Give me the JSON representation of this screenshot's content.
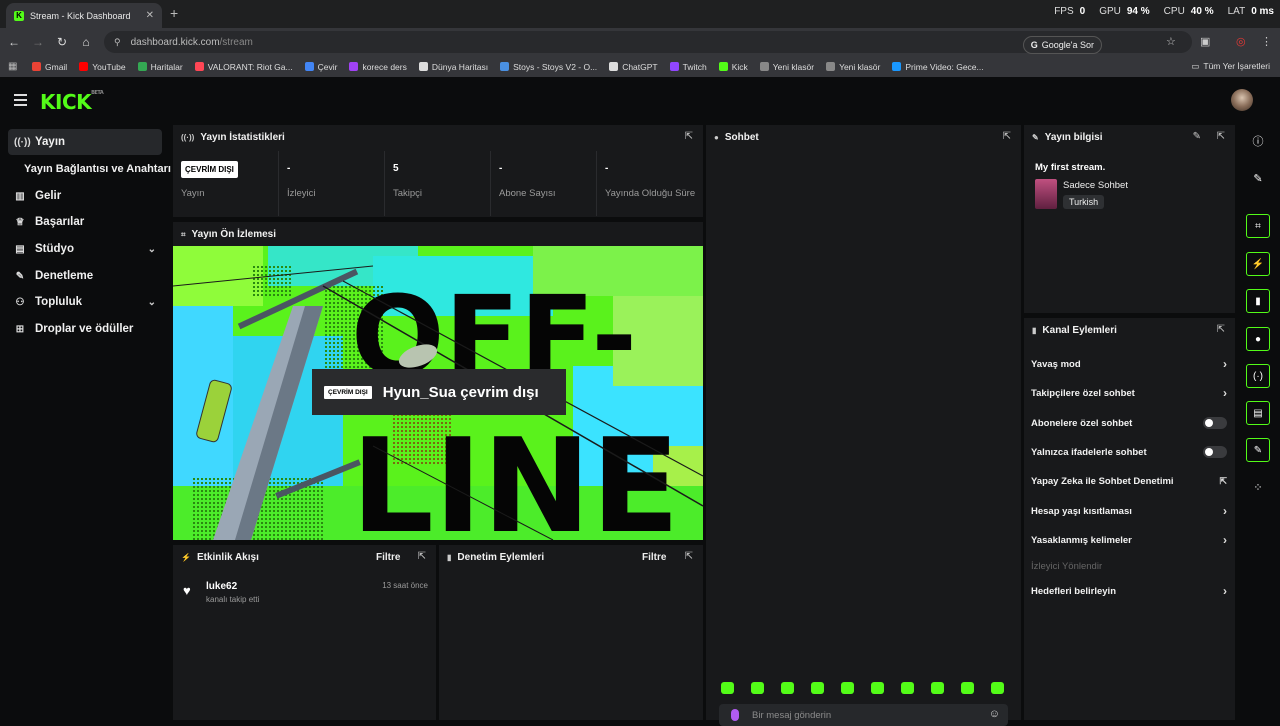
{
  "browser": {
    "tab_title": "Stream - Kick Dashboard",
    "new_tab": "+",
    "close_tab": "✕",
    "perf": [
      {
        "label": "FPS",
        "value": "0"
      },
      {
        "label": "GPU",
        "value": "94 %"
      },
      {
        "label": "CPU",
        "value": "40 %"
      },
      {
        "label": "LAT",
        "value": "0 ms"
      }
    ],
    "url_host": "dashboard.kick.com",
    "url_path": "/stream",
    "google_button": "Google'a Sor",
    "bookmarks": [
      {
        "label": "Gmail",
        "color": "#ea4335"
      },
      {
        "label": "YouTube",
        "color": "#ff0000"
      },
      {
        "label": "Haritalar",
        "color": "#34a853"
      },
      {
        "label": "VALORANT: Riot Ga...",
        "color": "#ff4655"
      },
      {
        "label": "Çevir",
        "color": "#4285f4"
      },
      {
        "label": "korece ders",
        "color": "#a142f4"
      },
      {
        "label": "Dünya Haritası",
        "color": "#dddddd"
      },
      {
        "label": "Stoys - Stoys V2 - O...",
        "color": "#4a90e2"
      },
      {
        "label": "ChatGPT",
        "color": "#dddddd"
      },
      {
        "label": "Twitch",
        "color": "#9146ff"
      },
      {
        "label": "Kick",
        "color": "#53fc18"
      },
      {
        "label": "Yeni klasör",
        "color": "#888888"
      },
      {
        "label": "Yeni klasör",
        "color": "#888888"
      },
      {
        "label": "Prime Video: Gece...",
        "color": "#1a98ff"
      }
    ],
    "all_bookmarks": "Tüm Yer İşaretleri"
  },
  "app": {
    "logo": "KICK",
    "logo_beta": "BETA",
    "accent": "#53fc18"
  },
  "sidebar": {
    "items": [
      {
        "label": "Yayın",
        "icon": "broadcast-icon"
      },
      {
        "label": "Yayın Bağlantısı ve Anahtarı",
        "icon": ""
      },
      {
        "label": "Gelir",
        "icon": "chart-icon"
      },
      {
        "label": "Başarılar",
        "icon": "trophy-icon"
      },
      {
        "label": "Stüdyo",
        "icon": "studio-icon"
      },
      {
        "label": "Denetleme",
        "icon": "wrench-icon"
      },
      {
        "label": "Topluluk",
        "icon": "people-icon"
      },
      {
        "label": "Droplar ve ödüller",
        "icon": "gift-icon"
      }
    ]
  },
  "stats": {
    "title": "Yayın İstatistikleri",
    "offline_badge": "ÇEVRİM DIŞI",
    "items": [
      {
        "value": "",
        "label": "Yayın"
      },
      {
        "value": "-",
        "label": "İzleyici"
      },
      {
        "value": "5",
        "label": "Takipçi"
      },
      {
        "value": "-",
        "label": "Abone Sayısı"
      },
      {
        "value": "-",
        "label": "Yayında Olduğu Süre"
      }
    ]
  },
  "preview": {
    "title": "Yayın Ön İzlemesi",
    "off_text": "OFF-",
    "line_text": "LINE",
    "badge": "ÇEVRİM DIŞI",
    "status": "Hyun_Sua çevrim dışı"
  },
  "activity": {
    "title": "Etkinlik Akışı",
    "filter": "Filtre",
    "items": [
      {
        "user": "luke62",
        "action": "kanalı takip etti",
        "time": "13 saat önce"
      }
    ]
  },
  "moderation": {
    "title": "Denetim Eylemleri",
    "filter": "Filtre"
  },
  "chat": {
    "title": "Sohbet",
    "placeholder": "Bir mesaj gönderin"
  },
  "stream_info": {
    "title": "Yayın bilgisi",
    "stream_title": "My first stream.",
    "category": "Sadece Sohbet",
    "language": "Turkish"
  },
  "channel_actions": {
    "title": "Kanal Eylemleri",
    "rows": [
      {
        "label": "Yavaş mod",
        "type": "arrow"
      },
      {
        "label": "Takipçilere özel sohbet",
        "type": "arrow"
      },
      {
        "label": "Abonelere özel sohbet",
        "type": "toggle"
      },
      {
        "label": "Yalnızca ifadelerle sohbet",
        "type": "toggle"
      },
      {
        "label": "Yapay Zeka ile Sohbet Denetimi",
        "type": "external"
      },
      {
        "label": "Hesap yaşı kısıtlaması",
        "type": "arrow"
      },
      {
        "label": "Yasaklanmış kelimeler",
        "type": "arrow"
      },
      {
        "label": "İzleyici Yönlendir",
        "type": "disabled"
      },
      {
        "label": "Hedefleri belirleyin",
        "type": "arrow"
      }
    ]
  }
}
